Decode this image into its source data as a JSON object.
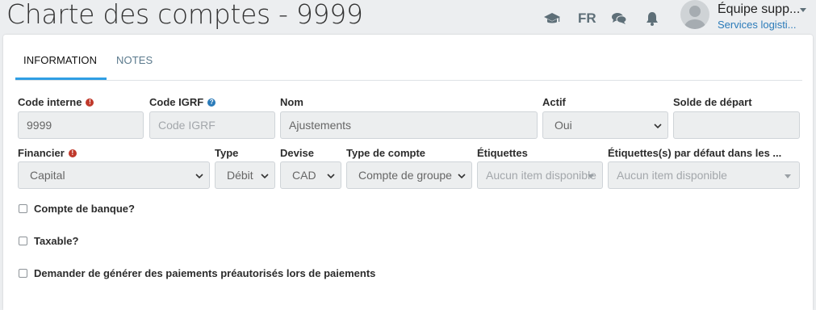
{
  "header": {
    "title": "Charte des comptes - 9999",
    "language": "FR",
    "user_name": "Équipe supp...",
    "user_subtitle": "Services logisti...",
    "icons": [
      "graduation-cap-icon",
      "comments-icon",
      "bell-icon",
      "avatar",
      "chevron-down-icon"
    ]
  },
  "tabs": [
    {
      "label": "INFORMATION",
      "active": true
    },
    {
      "label": "NOTES",
      "active": false
    }
  ],
  "fields": {
    "code_interne": {
      "label": "Code interne",
      "value": "9999",
      "required": true
    },
    "code_igrf": {
      "label": "Code IGRF",
      "placeholder": "Code IGRF",
      "help": true
    },
    "nom": {
      "label": "Nom",
      "value": "Ajustements"
    },
    "actif": {
      "label": "Actif",
      "value": "Oui"
    },
    "solde_depart": {
      "label": "Solde de départ",
      "value": ""
    },
    "financier": {
      "label": "Financier",
      "value": "Capital",
      "required": true
    },
    "type": {
      "label": "Type",
      "value": "Débit"
    },
    "devise": {
      "label": "Devise",
      "value": "CAD"
    },
    "type_compte": {
      "label": "Type de compte",
      "value": "Compte de groupe"
    },
    "etiquettes": {
      "label": "Étiquettes",
      "placeholder": "Aucun item disponible"
    },
    "etiquettes_defaut": {
      "label": "Étiquettes(s) par défaut dans les ...",
      "placeholder": "Aucun item disponible"
    }
  },
  "checkboxes": [
    {
      "label": "Compte de banque?",
      "checked": false
    },
    {
      "label": "Taxable?",
      "checked": false
    },
    {
      "label": "Demander de générer des paiements préautorisés lors de paiements",
      "checked": false
    }
  ],
  "colors": {
    "accent": "#2f9ee4",
    "required": "#c0392b",
    "help": "#2b7bb9",
    "link": "#2b7bb9"
  }
}
